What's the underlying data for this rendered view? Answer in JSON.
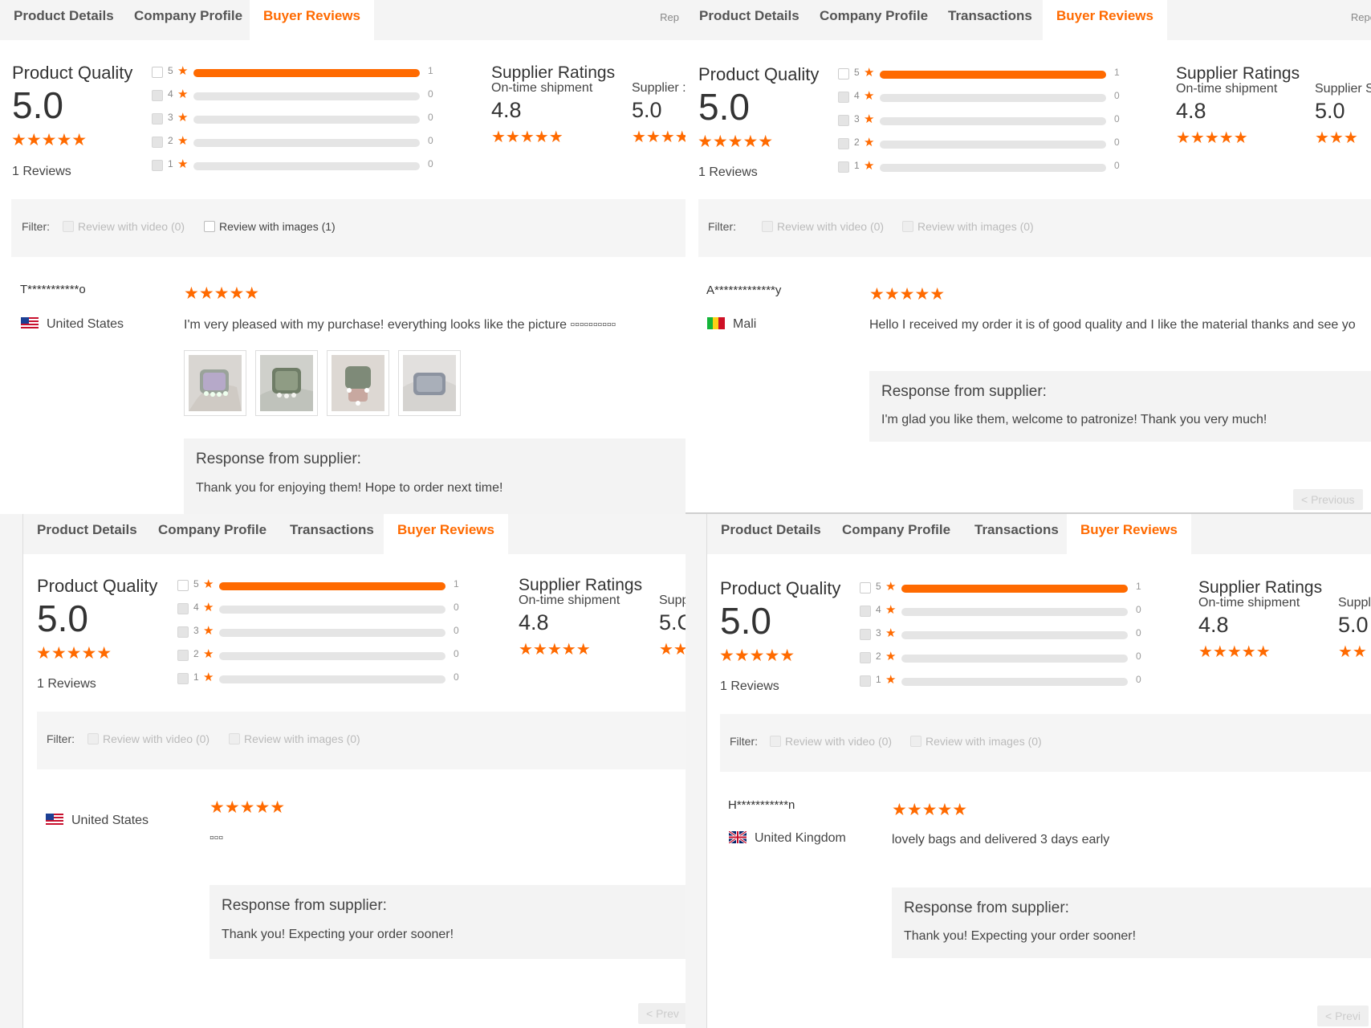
{
  "tab_labels": {
    "product_details": "Product Details",
    "company_profile": "Company Profile",
    "transactions": "Transactions",
    "buyer_reviews": "Buyer Reviews"
  },
  "colors": {
    "accent": "#ff6a00",
    "bar_track": "#e5e5e5",
    "filter_bg": "#f5f5f5",
    "response_bg": "#f3f3f3"
  },
  "panels": [
    {
      "tabs_right": "Rep",
      "product_quality": {
        "title": "Product Quality",
        "score": "5.0",
        "stars": "★★★★★",
        "reviews": "1 Reviews",
        "histogram": [
          {
            "star": "5",
            "count": "1",
            "fraction": 1
          },
          {
            "star": "4",
            "count": "0",
            "fraction": 0
          },
          {
            "star": "3",
            "count": "0",
            "fraction": 0
          },
          {
            "star": "2",
            "count": "0",
            "fraction": 0
          },
          {
            "star": "1",
            "count": "0",
            "fraction": 0
          }
        ]
      },
      "supplier_ratings": {
        "title": "Supplier Ratings",
        "on_time_label": "On-time shipment",
        "on_time_score": "4.8",
        "on_time_stars": "★★★★★",
        "second_label": "Supplier :",
        "second_score": "5.0",
        "second_stars": "★★★★"
      },
      "filter": {
        "label": "Filter:",
        "video": "Review with video (0)",
        "images": "Review with images (1)"
      },
      "review": {
        "reviewer": "T***********o",
        "country": "United States",
        "stars": "★★★★★",
        "text": "I'm very pleased with my purchase! everything looks like the picture ▫▫▫▫▫▫▫▫▫▫"
      },
      "response": {
        "title": "Response from supplier:",
        "text": "Thank you for enjoying them! Hope to order next time!"
      }
    },
    {
      "tabs_right": "Repo",
      "product_quality": {
        "title": "Product Quality",
        "score": "5.0",
        "stars": "★★★★★",
        "reviews": "1 Reviews",
        "histogram": [
          {
            "star": "5",
            "count": "1",
            "fraction": 1
          },
          {
            "star": "4",
            "count": "0",
            "fraction": 0
          },
          {
            "star": "3",
            "count": "0",
            "fraction": 0
          },
          {
            "star": "2",
            "count": "0",
            "fraction": 0
          },
          {
            "star": "1",
            "count": "0",
            "fraction": 0
          }
        ]
      },
      "supplier_ratings": {
        "title": "Supplier Ratings",
        "on_time_label": "On-time shipment",
        "on_time_score": "4.8",
        "on_time_stars": "★★★★★",
        "second_label": "Supplier S",
        "second_score": "5.0",
        "second_stars": "★★★"
      },
      "filter": {
        "label": "Filter:",
        "video": "Review with video (0)",
        "images": "Review with images (0)"
      },
      "review": {
        "reviewer": "A*************y",
        "country": "Mali",
        "stars": "★★★★★",
        "text": "Hello I received my order it is of good quality and I like the material thanks and see yo"
      },
      "response": {
        "title": "Response from supplier:",
        "text": "I'm glad you like them, welcome to patronize! Thank you very much!"
      },
      "pager": "< Previous"
    },
    {
      "product_quality": {
        "title": "Product Quality",
        "score": "5.0",
        "stars": "★★★★★",
        "reviews": "1 Reviews",
        "histogram": [
          {
            "star": "5",
            "count": "1",
            "fraction": 1
          },
          {
            "star": "4",
            "count": "0",
            "fraction": 0
          },
          {
            "star": "3",
            "count": "0",
            "fraction": 0
          },
          {
            "star": "2",
            "count": "0",
            "fraction": 0
          },
          {
            "star": "1",
            "count": "0",
            "fraction": 0
          }
        ]
      },
      "supplier_ratings": {
        "title": "Supplier Ratings",
        "on_time_label": "On-time shipment",
        "on_time_score": "4.8",
        "on_time_stars": "★★★★★",
        "second_label": "Supp",
        "second_score": "5.C",
        "second_stars": "★★"
      },
      "filter": {
        "label": "Filter:",
        "video": "Review with video (0)",
        "images": "Review with images (0)"
      },
      "review": {
        "country": "United States",
        "stars": "★★★★★",
        "text": "▫▫▫"
      },
      "response": {
        "title": "Response from supplier:",
        "text": "Thank you! Expecting your order sooner!"
      },
      "pager": "< Prev"
    },
    {
      "product_quality": {
        "title": "Product Quality",
        "score": "5.0",
        "stars": "★★★★★",
        "reviews": "1 Reviews",
        "histogram": [
          {
            "star": "5",
            "count": "1",
            "fraction": 1
          },
          {
            "star": "4",
            "count": "0",
            "fraction": 0
          },
          {
            "star": "3",
            "count": "0",
            "fraction": 0
          },
          {
            "star": "2",
            "count": "0",
            "fraction": 0
          },
          {
            "star": "1",
            "count": "0",
            "fraction": 0
          }
        ]
      },
      "supplier_ratings": {
        "title": "Supplier Ratings",
        "on_time_label": "On-time shipment",
        "on_time_score": "4.8",
        "on_time_stars": "★★★★★",
        "second_label": "Suppl",
        "second_score": "5.0",
        "second_stars": "★★"
      },
      "filter": {
        "label": "Filter:",
        "video": "Review with video (0)",
        "images": "Review with images (0)"
      },
      "review": {
        "reviewer": "H***********n",
        "country": "United Kingdom",
        "stars": "★★★★★",
        "text": "lovely bags and delivered 3 days early"
      },
      "response": {
        "title": "Response from supplier:",
        "text": "Thank you! Expecting your order sooner!"
      },
      "pager": "< Previ"
    }
  ]
}
